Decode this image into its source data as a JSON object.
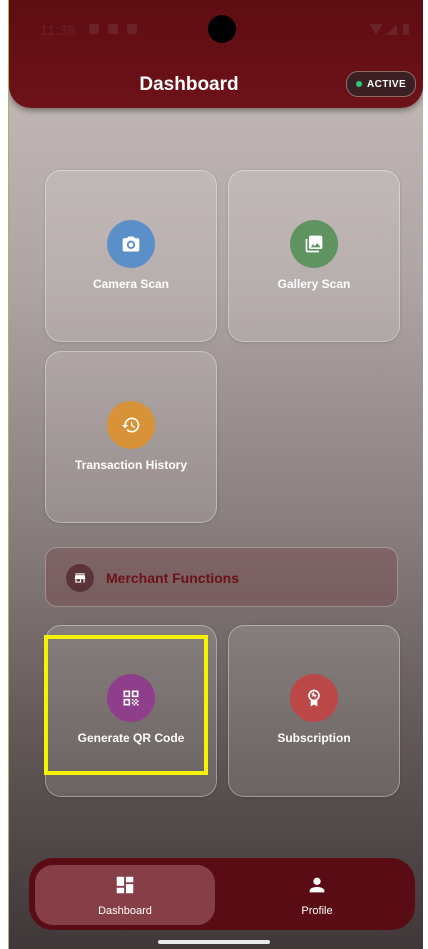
{
  "status_bar": {
    "time": "11:38"
  },
  "header": {
    "title": "Dashboard",
    "status_badge": "ACTIVE"
  },
  "colors": {
    "brand": "#6d1218",
    "active_dot": "#2ec77a",
    "highlight": "#f6f300"
  },
  "cards": {
    "camera": {
      "label": "Camera Scan",
      "icon": "camera-icon",
      "color": "#5a8fc8"
    },
    "gallery": {
      "label": "Gallery Scan",
      "icon": "image-icon",
      "color": "#5f9460"
    },
    "history": {
      "label": "Transaction History",
      "icon": "history-icon",
      "color": "#d89238"
    }
  },
  "merchant": {
    "section_label": "Merchant Functions",
    "icon": "store-icon",
    "cards": {
      "qr": {
        "label": "Generate QR Code",
        "icon": "qr-code-icon",
        "color": "#8e3e8a"
      },
      "subscription": {
        "label": "Subscription",
        "icon": "award-icon",
        "color": "#bb4747"
      }
    }
  },
  "bottom_nav": {
    "dashboard": {
      "label": "Dashboard",
      "icon": "dashboard-icon"
    },
    "profile": {
      "label": "Profile",
      "icon": "person-icon"
    }
  }
}
